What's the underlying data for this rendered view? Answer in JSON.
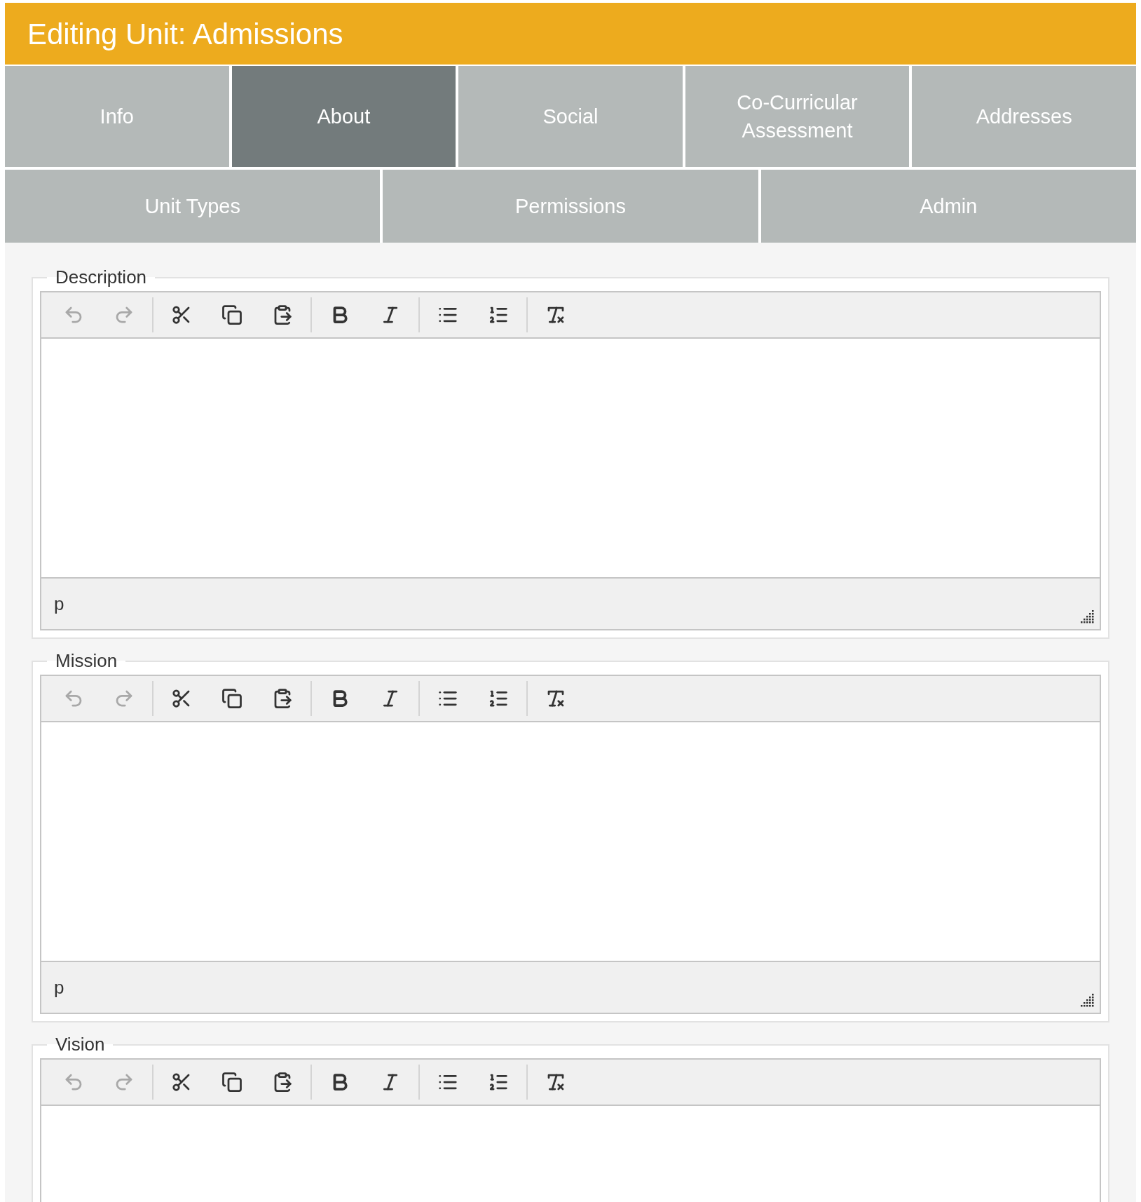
{
  "header": {
    "title": "Editing Unit: Admissions"
  },
  "tab_rows": [
    [
      {
        "label": "Info",
        "selected": false
      },
      {
        "label": "About",
        "selected": true
      },
      {
        "label": "Social",
        "selected": false
      },
      {
        "label": "Co-Curricular Assessment",
        "selected": false
      },
      {
        "label": "Addresses",
        "selected": false
      }
    ],
    [
      {
        "label": "Unit Types",
        "selected": false
      },
      {
        "label": "Permissions",
        "selected": false
      },
      {
        "label": "Admin",
        "selected": false
      }
    ]
  ],
  "editors": [
    {
      "label": "Description",
      "status_path": "p",
      "toolbar": [
        {
          "kind": "undo",
          "disabled": true
        },
        {
          "kind": "redo",
          "disabled": true
        },
        {
          "kind": "cut",
          "disabled": false
        },
        {
          "kind": "copy",
          "disabled": false
        },
        {
          "kind": "paste",
          "disabled": false
        },
        {
          "kind": "bold",
          "disabled": false
        },
        {
          "kind": "italic",
          "disabled": false
        },
        {
          "kind": "bullets",
          "disabled": false
        },
        {
          "kind": "numbers",
          "disabled": false
        },
        {
          "kind": "clear",
          "disabled": false
        }
      ]
    },
    {
      "label": "Mission",
      "status_path": "p",
      "toolbar": [
        {
          "kind": "undo",
          "disabled": true
        },
        {
          "kind": "redo",
          "disabled": true
        },
        {
          "kind": "cut",
          "disabled": false
        },
        {
          "kind": "copy",
          "disabled": false
        },
        {
          "kind": "paste",
          "disabled": false
        },
        {
          "kind": "bold",
          "disabled": false
        },
        {
          "kind": "italic",
          "disabled": false
        },
        {
          "kind": "bullets",
          "disabled": false
        },
        {
          "kind": "numbers",
          "disabled": false
        },
        {
          "kind": "clear",
          "disabled": false
        }
      ]
    },
    {
      "label": "Vision",
      "toolbar": [
        {
          "kind": "undo",
          "disabled": true
        },
        {
          "kind": "redo",
          "disabled": true
        },
        {
          "kind": "cut",
          "disabled": false
        },
        {
          "kind": "copy",
          "disabled": false
        },
        {
          "kind": "paste",
          "disabled": false
        },
        {
          "kind": "bold",
          "disabled": false
        },
        {
          "kind": "italic",
          "disabled": false
        },
        {
          "kind": "bullets",
          "disabled": false
        },
        {
          "kind": "numbers",
          "disabled": false
        },
        {
          "kind": "clear",
          "disabled": false
        }
      ]
    }
  ]
}
